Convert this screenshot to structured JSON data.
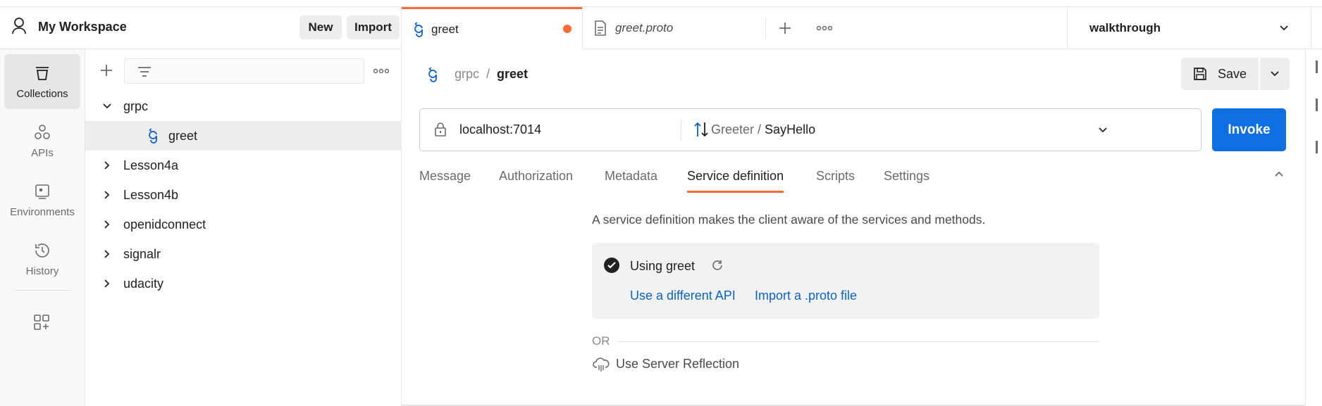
{
  "workspace": {
    "title": "My Workspace",
    "new_label": "New",
    "import_label": "Import"
  },
  "rail": {
    "items": [
      {
        "label": "Collections",
        "icon": "collections-icon",
        "active": true
      },
      {
        "label": "APIs",
        "icon": "apis-icon",
        "active": false
      },
      {
        "label": "Environments",
        "icon": "environments-icon",
        "active": false
      },
      {
        "label": "History",
        "icon": "history-icon",
        "active": false
      }
    ],
    "add_icon": "add-apps-icon"
  },
  "sidebar": {
    "tree": [
      {
        "label": "grpc",
        "expanded": true,
        "level": 0
      },
      {
        "label": "greet",
        "level": 1,
        "selected": true,
        "icon": "grpc-icon"
      },
      {
        "label": "Lesson4a",
        "expanded": false,
        "level": 0
      },
      {
        "label": "Lesson4b",
        "expanded": false,
        "level": 0
      },
      {
        "label": "openidconnect",
        "expanded": false,
        "level": 0
      },
      {
        "label": "signalr",
        "expanded": false,
        "level": 0
      },
      {
        "label": "udacity",
        "expanded": false,
        "level": 0
      }
    ]
  },
  "tabs": {
    "items": [
      {
        "label": "greet",
        "active": true,
        "unsaved": true
      },
      {
        "label": "greet.proto",
        "active": false
      }
    ],
    "environment": "walkthrough"
  },
  "request": {
    "breadcrumb_parent": "grpc",
    "breadcrumb_sep": "/",
    "breadcrumb_current": "greet",
    "save_label": "Save",
    "url": "localhost:7014",
    "service": "Greeter",
    "method_sep": " / ",
    "method": "SayHello",
    "invoke_label": "Invoke"
  },
  "subtabs": [
    {
      "label": "Message",
      "active": false
    },
    {
      "label": "Authorization",
      "active": false
    },
    {
      "label": "Metadata",
      "active": false
    },
    {
      "label": "Service definition",
      "active": true
    },
    {
      "label": "Scripts",
      "active": false
    },
    {
      "label": "Settings",
      "active": false
    }
  ],
  "service_definition": {
    "description": "A service definition makes the client aware of the services and methods.",
    "using_label": "Using greet",
    "different_api_label": "Use a different API",
    "import_proto_label": "Import a .proto file",
    "or_label": "OR",
    "reflection_label": "Use Server Reflection"
  },
  "colors": {
    "accent": "#ff6c37",
    "primary": "#0d6fe0",
    "link": "#0b63c7"
  }
}
